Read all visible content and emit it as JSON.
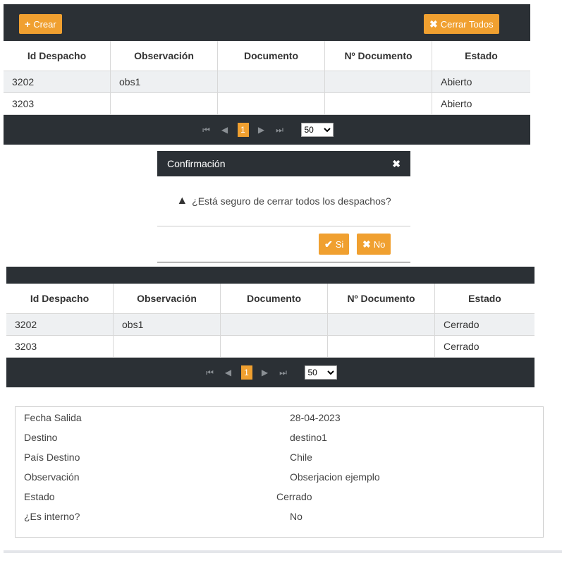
{
  "grid1": {
    "create_label": "Crear",
    "close_all_label": "Cerrar Todos",
    "columns": [
      "Id Despacho",
      "Observación",
      "Documento",
      "Nº Documento",
      "Estado"
    ],
    "rows": [
      [
        "3202",
        "obs1",
        "",
        "",
        "Abierto"
      ],
      [
        "3203",
        "",
        "",
        "",
        "Abierto"
      ]
    ],
    "pager": {
      "current_page": "1",
      "page_size": "50"
    }
  },
  "dialog": {
    "title": "Confirmación",
    "message": "¿Está seguro de cerrar todos los despachos?",
    "yes_label": "Si",
    "no_label": "No"
  },
  "grid2": {
    "columns": [
      "Id Despacho",
      "Observación",
      "Documento",
      "Nº Documento",
      "Estado"
    ],
    "rows": [
      [
        "3202",
        "obs1",
        "",
        "",
        "Cerrado"
      ],
      [
        "3203",
        "",
        "",
        "",
        "Cerrado"
      ]
    ],
    "pager": {
      "current_page": "1",
      "page_size": "50"
    }
  },
  "details": [
    {
      "label": "Fecha Salida",
      "value": "28-04-2023"
    },
    {
      "label": "Destino",
      "value": "destino1"
    },
    {
      "label": "País Destino",
      "value": "Chile"
    },
    {
      "label": "Observación",
      "value": "Obserjacion ejemplo"
    },
    {
      "label": "Estado",
      "value": "Cerrado"
    },
    {
      "label": "¿Es interno?",
      "value": "No"
    }
  ],
  "colors": {
    "accent": "#f0a030",
    "dark": "#2b3035",
    "stripe": "#eef0f2"
  }
}
